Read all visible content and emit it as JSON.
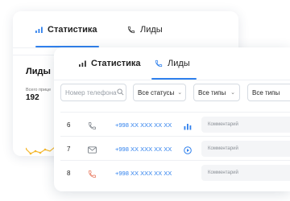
{
  "back_card": {
    "tabs": [
      {
        "label": "Статистика",
        "icon": "bar-chart-icon",
        "active": true
      },
      {
        "label": "Лиды",
        "icon": "phone-icon",
        "active": false
      }
    ],
    "leads_panel": {
      "title": "Лиды",
      "total_label": "Всего прице",
      "total_value": "192"
    }
  },
  "front_card": {
    "tabs": [
      {
        "label": "Статистика",
        "icon": "bar-chart-icon",
        "active": false
      },
      {
        "label": "Лиды",
        "icon": "phone-icon",
        "active": true
      }
    ],
    "filters": {
      "search_placeholder": "Номер телефона",
      "status_value": "Все статусы",
      "type1_value": "Все типы",
      "type2_value": "Все типы"
    },
    "rows": [
      {
        "id": "6",
        "type_icon": "phone-icon",
        "phone": "+998 XX XXX XX XX",
        "action_icon": "stats-icon",
        "comment_placeholder": "Комментарий"
      },
      {
        "id": "7",
        "type_icon": "mail-icon",
        "phone": "+998 XX XXX XX XX",
        "action_icon": "play-icon",
        "comment_placeholder": "Комментарий"
      },
      {
        "id": "8",
        "type_icon": "missed-call-icon",
        "phone": "+998 XX XXX XX XX",
        "action_icon": "",
        "comment_placeholder": "Комментарий"
      }
    ]
  },
  "colors": {
    "accent": "#2f80ed",
    "sparkline": "#f5b82e",
    "missed": "#e8765b"
  }
}
